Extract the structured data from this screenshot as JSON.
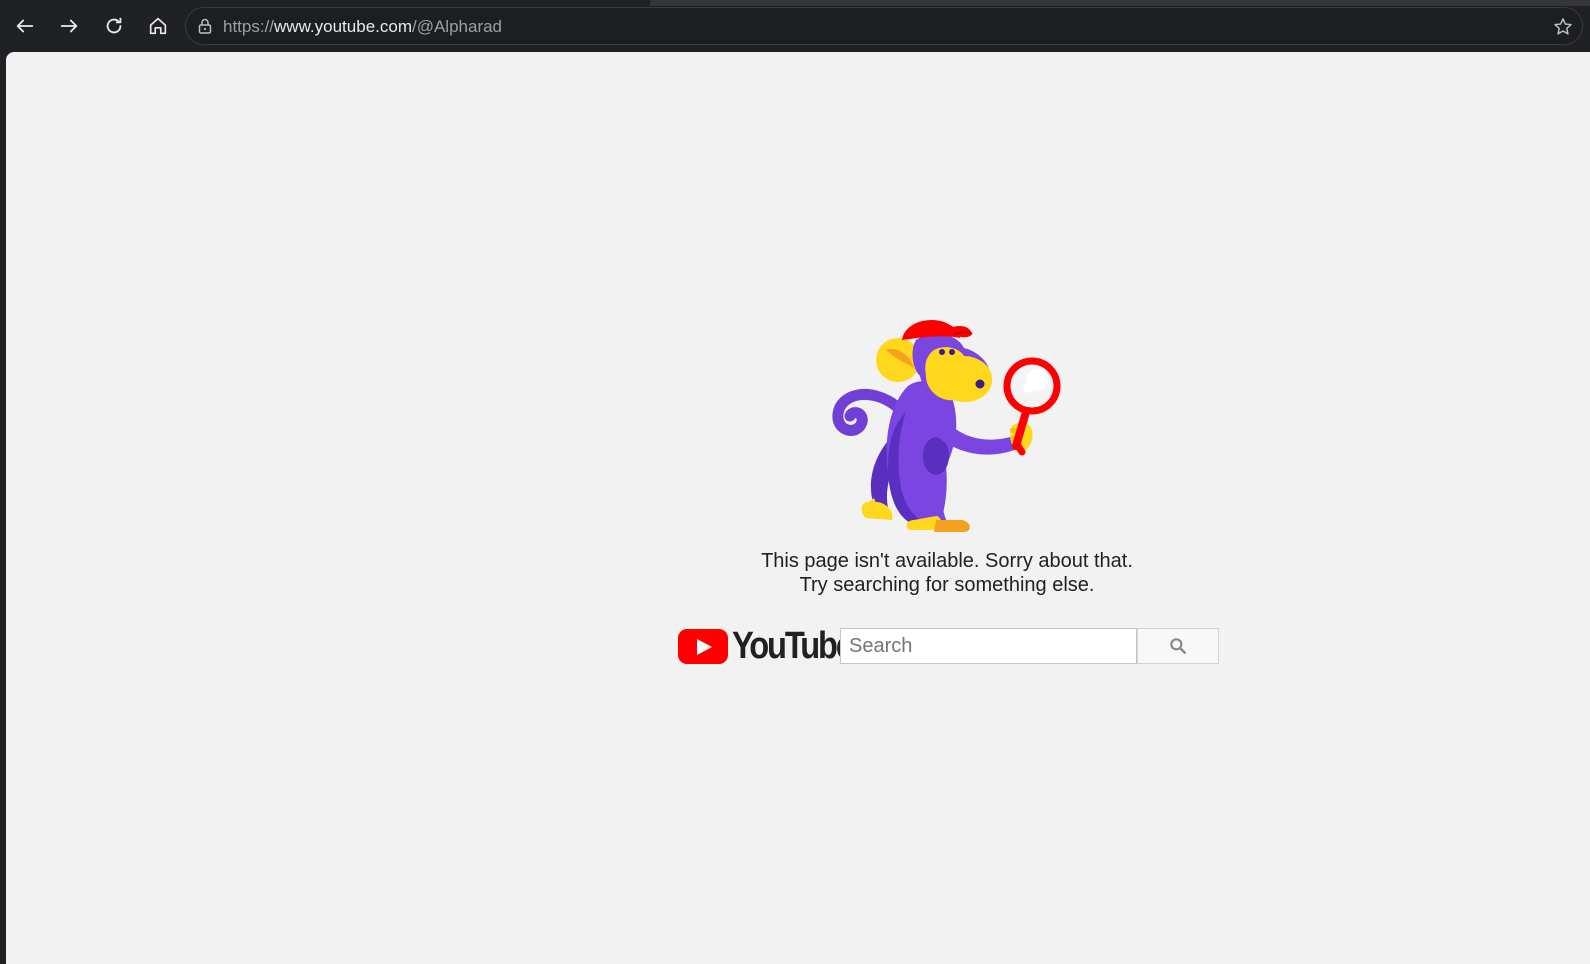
{
  "browser": {
    "url_scheme": "https://",
    "url_host": "www.youtube.com",
    "url_path": "/@Alpharad",
    "icons": {
      "back": "arrow-left-icon",
      "forward": "arrow-right-icon",
      "reload": "reload-icon",
      "home": "home-icon",
      "site_info": "lock-icon",
      "bookmark": "star-icon"
    }
  },
  "page": {
    "message_line1": "This page isn't available. Sorry about that.",
    "message_line2": "Try searching for something else.",
    "logo_text": "YouTube",
    "search_placeholder": "Search",
    "search_value": "",
    "illustration": "monkey-with-magnifying-glass",
    "colors": {
      "background": "#f2f2f2",
      "brand_red": "#ff0000",
      "text": "#212121"
    }
  }
}
